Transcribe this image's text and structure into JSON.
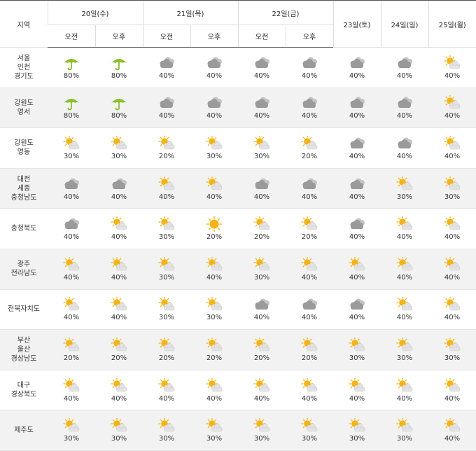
{
  "header": {
    "region_label": "지역",
    "days": [
      "20일(수)",
      "21일(목)",
      "22일(금)",
      "23일(토)",
      "24일(일)",
      "25일(월)"
    ],
    "am": "오전",
    "pm": "오후"
  },
  "rows": [
    {
      "region": [
        "서울",
        "인천",
        "경기도"
      ],
      "cells": [
        [
          "umbrella",
          "80%"
        ],
        [
          "umbrella",
          "80%"
        ],
        [
          "cloud",
          "40%"
        ],
        [
          "cloud",
          "40%"
        ],
        [
          "cloud",
          "40%"
        ],
        [
          "cloud",
          "40%"
        ],
        [
          "cloud",
          "40%"
        ],
        [
          "cloud",
          "40%"
        ],
        [
          "partly",
          "40%"
        ]
      ]
    },
    {
      "region": [
        "강원도",
        "영서"
      ],
      "cells": [
        [
          "umbrella",
          "80%"
        ],
        [
          "umbrella",
          "80%"
        ],
        [
          "cloud",
          "40%"
        ],
        [
          "cloud",
          "40%"
        ],
        [
          "cloud",
          "40%"
        ],
        [
          "cloud",
          "40%"
        ],
        [
          "cloud",
          "40%"
        ],
        [
          "cloud",
          "40%"
        ],
        [
          "partly",
          "40%"
        ]
      ]
    },
    {
      "region": [
        "강원도",
        "영동"
      ],
      "cells": [
        [
          "partly",
          "30%"
        ],
        [
          "partly",
          "30%"
        ],
        [
          "partly",
          "20%"
        ],
        [
          "partly",
          "30%"
        ],
        [
          "partly",
          "30%"
        ],
        [
          "partly",
          "20%"
        ],
        [
          "cloud",
          "40%"
        ],
        [
          "cloud",
          "40%"
        ],
        [
          "partly",
          "40%"
        ]
      ]
    },
    {
      "region": [
        "대전",
        "세종",
        "충청남도"
      ],
      "cells": [
        [
          "cloud",
          "40%"
        ],
        [
          "cloud",
          "40%"
        ],
        [
          "partly",
          "40%"
        ],
        [
          "partly",
          "40%"
        ],
        [
          "cloud",
          "40%"
        ],
        [
          "cloud",
          "40%"
        ],
        [
          "cloud",
          "40%"
        ],
        [
          "partly",
          "30%"
        ],
        [
          "partly",
          "30%"
        ]
      ]
    },
    {
      "region": [
        "충청북도"
      ],
      "cells": [
        [
          "cloud",
          "40%"
        ],
        [
          "partly",
          "40%"
        ],
        [
          "partly",
          "30%"
        ],
        [
          "sunny",
          "20%"
        ],
        [
          "partly",
          "20%"
        ],
        [
          "partly",
          "20%"
        ],
        [
          "cloud",
          "40%"
        ],
        [
          "partly",
          "40%"
        ],
        [
          "partly",
          "40%"
        ]
      ]
    },
    {
      "region": [
        "광주",
        "전라남도"
      ],
      "cells": [
        [
          "partly",
          "40%"
        ],
        [
          "partly",
          "40%"
        ],
        [
          "partly",
          "30%"
        ],
        [
          "partly",
          "40%"
        ],
        [
          "partly",
          "30%"
        ],
        [
          "partly",
          "40%"
        ],
        [
          "partly",
          "40%"
        ],
        [
          "partly",
          "40%"
        ],
        [
          "partly",
          "40%"
        ]
      ]
    },
    {
      "region": [
        "전북자치도"
      ],
      "cells": [
        [
          "partly",
          "40%"
        ],
        [
          "partly",
          "40%"
        ],
        [
          "partly",
          "30%"
        ],
        [
          "partly",
          "30%"
        ],
        [
          "cloud",
          "40%"
        ],
        [
          "cloud",
          "40%"
        ],
        [
          "cloud",
          "40%"
        ],
        [
          "partly",
          "40%"
        ],
        [
          "partly",
          "40%"
        ]
      ]
    },
    {
      "region": [
        "부산",
        "울산",
        "경상남도"
      ],
      "cells": [
        [
          "partly",
          "20%"
        ],
        [
          "partly",
          "20%"
        ],
        [
          "partly",
          "20%"
        ],
        [
          "partly",
          "20%"
        ],
        [
          "partly",
          "20%"
        ],
        [
          "partly",
          "20%"
        ],
        [
          "partly",
          "30%"
        ],
        [
          "partly",
          "30%"
        ],
        [
          "partly",
          "30%"
        ]
      ]
    },
    {
      "region": [
        "대구",
        "경상북도"
      ],
      "cells": [
        [
          "partly",
          "40%"
        ],
        [
          "partly",
          "40%"
        ],
        [
          "partly",
          "40%"
        ],
        [
          "partly",
          "40%"
        ],
        [
          "partly",
          "40%"
        ],
        [
          "partly",
          "40%"
        ],
        [
          "partly",
          "40%"
        ],
        [
          "partly",
          "40%"
        ],
        [
          "partly",
          "40%"
        ]
      ]
    },
    {
      "region": [
        "제주도"
      ],
      "cells": [
        [
          "partly",
          "30%"
        ],
        [
          "partly",
          "30%"
        ],
        [
          "partly",
          "30%"
        ],
        [
          "partly",
          "30%"
        ],
        [
          "partly",
          "30%"
        ],
        [
          "partly",
          "30%"
        ],
        [
          "partly",
          "30%"
        ],
        [
          "partly",
          "30%"
        ],
        [
          "partly",
          "40%"
        ]
      ]
    }
  ],
  "icons": {
    "umbrella": "umbrella-rain-icon",
    "cloud": "cloudy-icon",
    "partly": "partly-cloudy-icon",
    "sunny": "sunny-icon"
  },
  "colors": {
    "umbrella": "#8cbf2a",
    "sun": "#f5b416",
    "cloud": "#9a9a9a"
  }
}
